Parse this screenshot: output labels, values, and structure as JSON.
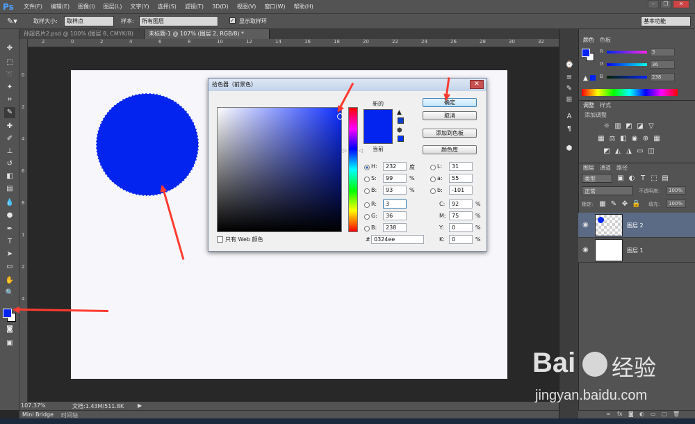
{
  "app": {
    "logo": "Ps"
  },
  "menu": [
    "文件(F)",
    "编辑(E)",
    "图像(I)",
    "图层(L)",
    "文字(Y)",
    "选择(S)",
    "滤镜(T)",
    "3D(D)",
    "视图(V)",
    "窗口(W)",
    "帮助(H)"
  ],
  "options": {
    "sample_size_label": "取样大小:",
    "sample_size_value": "取样点",
    "sample_label": "样本:",
    "sample_value": "所有图层",
    "show_ring_label": "显示取样环",
    "workspace": "基本功能"
  },
  "tabs": [
    "孙超名片2.psd @ 100% (图层 8, CMYK/8)",
    "未标题-1 @ 107% (图层 2, RGB/8) *"
  ],
  "ruler": {
    "h_ticks": [
      "2",
      "0",
      "2",
      "4",
      "6",
      "8",
      "10",
      "12",
      "14",
      "16",
      "18",
      "20",
      "22",
      "24",
      "26",
      "28",
      "30",
      "32"
    ],
    "v_ticks": [
      "0",
      "2",
      "4",
      "6",
      "8",
      "1",
      "2",
      "4"
    ]
  },
  "status": {
    "zoom": "107.37%",
    "doc": "文档:1.43M/511.8K"
  },
  "bottom_tabs": [
    "Mini Bridge",
    "时间轴"
  ],
  "color_panel": {
    "tabs": [
      "颜色",
      "色板"
    ],
    "channels": [
      {
        "name": "R",
        "value": "3"
      },
      {
        "name": "G",
        "value": "36"
      },
      {
        "name": "B",
        "value": "238"
      }
    ]
  },
  "adjust_panel": {
    "tabs": [
      "调整",
      "样式"
    ],
    "title": "添加调整"
  },
  "layers_panel": {
    "tabs": [
      "图层",
      "通道",
      "路径"
    ],
    "filter": "类型",
    "blend": "正常",
    "opacity_label": "不透明度:",
    "opacity_value": "100%",
    "lock_label": "锁定:",
    "fill_label": "填充:",
    "fill_value": "100%",
    "layers": [
      {
        "name": "图层 2",
        "selected": true
      },
      {
        "name": "图层 1",
        "selected": false
      }
    ]
  },
  "dialog": {
    "title": "拾色器（前景色）",
    "new_label": "新的",
    "current_label": "当前",
    "buttons": {
      "ok": "确定",
      "cancel": "取消",
      "add_swatch": "添加到色板",
      "libraries": "颜色库"
    },
    "fields": {
      "H": {
        "label": "H:",
        "value": "232",
        "unit": "度"
      },
      "S": {
        "label": "S:",
        "value": "99",
        "unit": "%"
      },
      "Bv": {
        "label": "B:",
        "value": "93",
        "unit": "%"
      },
      "R": {
        "label": "R:",
        "value": "3"
      },
      "G": {
        "label": "G:",
        "value": "36"
      },
      "B": {
        "label": "B:",
        "value": "238"
      },
      "L": {
        "label": "L:",
        "value": "31"
      },
      "a": {
        "label": "a:",
        "value": "55"
      },
      "b": {
        "label": "b:",
        "value": "-101"
      },
      "C": {
        "label": "C:",
        "value": "92",
        "unit": "%"
      },
      "M": {
        "label": "M:",
        "value": "75",
        "unit": "%"
      },
      "Y": {
        "label": "Y:",
        "value": "0",
        "unit": "%"
      },
      "K": {
        "label": "K:",
        "value": "0",
        "unit": "%"
      }
    },
    "hex_label": "#",
    "hex_value": "0324ee",
    "web_only_label": "只有 Web 颜色"
  },
  "colors": {
    "foreground": "#0324ee",
    "accent_arrow": "#ff3b30"
  },
  "watermark": {
    "brand": "Bai",
    "brand_suffix": "经验",
    "url": "jingyan.baidu.com"
  }
}
